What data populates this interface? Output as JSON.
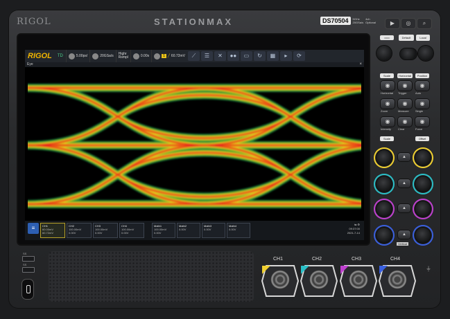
{
  "front_panel": {
    "brand": "RIGOL",
    "series": "STATIONMAX",
    "model": "DS70504",
    "model_spec_lines": [
      "5GHz",
      "20GSa/s",
      "4ch",
      "Optional"
    ],
    "top_buttons": [
      "run-stop",
      "single",
      "auto"
    ]
  },
  "toolbar": {
    "logo": "RIGOL",
    "mode": "TD",
    "timebase": "5.00ps/",
    "sample_rate": "20GSa/s",
    "acq_mode_lines": [
      "Highr",
      "Rsmpl"
    ],
    "offset": "0.00s",
    "trigger_channel": "1",
    "trigger_level": "60.72mV",
    "icons": [
      "ruler-icon",
      "list-icon",
      "zoom-icon",
      "link-icon",
      "window-icon",
      "history-icon",
      "grid-icon",
      "arrow-icon",
      "cycle-icon"
    ]
  },
  "window": {
    "title": "Eye",
    "close": "×"
  },
  "status_bar": {
    "menu_glyph": "≡",
    "channels": [
      {
        "name": "CH1",
        "line1": "60.00mV",
        "line2": "60.72mV",
        "active": true
      },
      {
        "name": "CH2",
        "line1": "100.00mV",
        "line2": "0.00V",
        "active": false
      },
      {
        "name": "CH3",
        "line1": "100.00mV",
        "line2": "0.00V",
        "active": false
      },
      {
        "name": "CH4",
        "line1": "100.00mV",
        "line2": "0.00V",
        "active": false
      },
      {
        "name": "Math1",
        "line1": "100.00mV",
        "line2": "0.00V",
        "active": false
      },
      {
        "name": "Math2",
        "line1": "",
        "line2": "0.00V",
        "active": false
      },
      {
        "name": "Math3",
        "line1": "",
        "line2": "0.00V",
        "active": false
      },
      {
        "name": "Math4",
        "line1": "",
        "line2": "0.00V",
        "active": false
      }
    ],
    "clock_lines": [
      "09:37:00",
      "2021-7-14"
    ]
  },
  "controls": {
    "default_label": "Default",
    "local_label": "Local",
    "top_pills": [
      "Scale",
      "Horizontal",
      "Position"
    ],
    "buttons": [
      "Horizontal",
      "Trigger",
      "Auto",
      "Zoom",
      "Measure",
      "Single",
      "Intensity",
      "Clear",
      "Force"
    ],
    "mid_pills": [
      "Scale",
      "Offset"
    ],
    "vertical_label": "Vertical"
  },
  "channels": {
    "labels": [
      "CH1",
      "CH2",
      "CH3",
      "CH4"
    ],
    "colors": [
      "#f0d030",
      "#2bc0c8",
      "#c040d0",
      "#3a60e0"
    ]
  },
  "ports": {
    "usb_labels": [
      "SS",
      "SS"
    ]
  },
  "chart_data": {
    "type": "eye",
    "title": "Eye",
    "levels": 3,
    "crossings": 2,
    "color_scale": [
      "#1a7a3a",
      "#2ea12b",
      "#d9d91f",
      "#f07a12",
      "#e61a1a"
    ]
  }
}
